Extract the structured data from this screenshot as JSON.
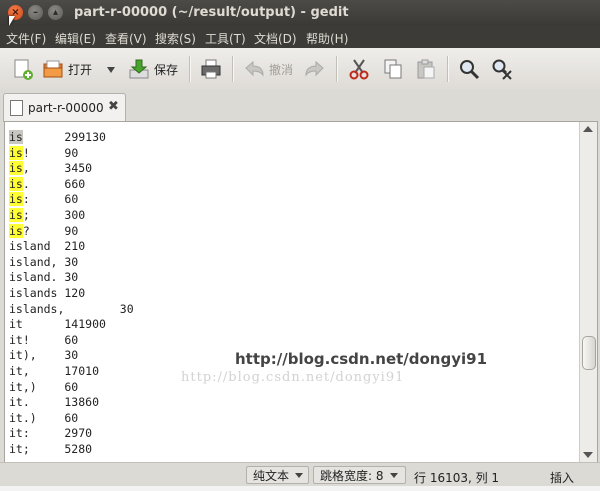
{
  "window": {
    "title": "part-r-00000 (~/result/output) - gedit",
    "close_glyph": "×",
    "min_glyph": "–",
    "max_glyph": "▴"
  },
  "menu": [
    "文件(F)",
    "编辑(E)",
    "查看(V)",
    "搜索(S)",
    "工具(T)",
    "文档(D)",
    "帮助(H)"
  ],
  "toolbar": {
    "open_label": "打开",
    "save_label": "保存",
    "undo_label": "撤消"
  },
  "tab": {
    "label": "part-r-00000",
    "close_glyph": "✖"
  },
  "editor": {
    "lines": [
      {
        "text": "is\t299130",
        "hl": "is",
        "hl_style": "current"
      },
      {
        "text": "is!\t90",
        "hl": "is",
        "hl_style": "match"
      },
      {
        "text": "is,\t3450",
        "hl": "is",
        "hl_style": "match"
      },
      {
        "text": "is.\t660",
        "hl": "is",
        "hl_style": "match"
      },
      {
        "text": "is:\t60",
        "hl": "is",
        "hl_style": "match"
      },
      {
        "text": "is;\t300",
        "hl": "is",
        "hl_style": "match"
      },
      {
        "text": "is?\t90",
        "hl": "is",
        "hl_style": "match"
      },
      {
        "text": "island\t210"
      },
      {
        "text": "island,\t30"
      },
      {
        "text": "island.\t30"
      },
      {
        "text": "islands\t120"
      },
      {
        "text": "islands,\t30"
      },
      {
        "text": "it\t141900"
      },
      {
        "text": "it!\t60"
      },
      {
        "text": "it),\t30"
      },
      {
        "text": "it,\t17010"
      },
      {
        "text": "it,)\t60"
      },
      {
        "text": "it.\t13860"
      },
      {
        "text": "it.)\t60"
      },
      {
        "text": "it:\t2970"
      },
      {
        "text": "it;\t5280"
      }
    ]
  },
  "watermark": {
    "primary": "http://blog.csdn.net/dongyi91",
    "secondary": "http://blog.csdn.net/dongyi91"
  },
  "status": {
    "mode": "纯文本",
    "tab_width": "跳格宽度: 8",
    "position": "行 16103, 列 1",
    "insert_mode": "插入"
  },
  "colors": {
    "match_highlight": "#ffff33",
    "current_match": "#c8c6c0",
    "title_bar": "#3c3b37"
  }
}
